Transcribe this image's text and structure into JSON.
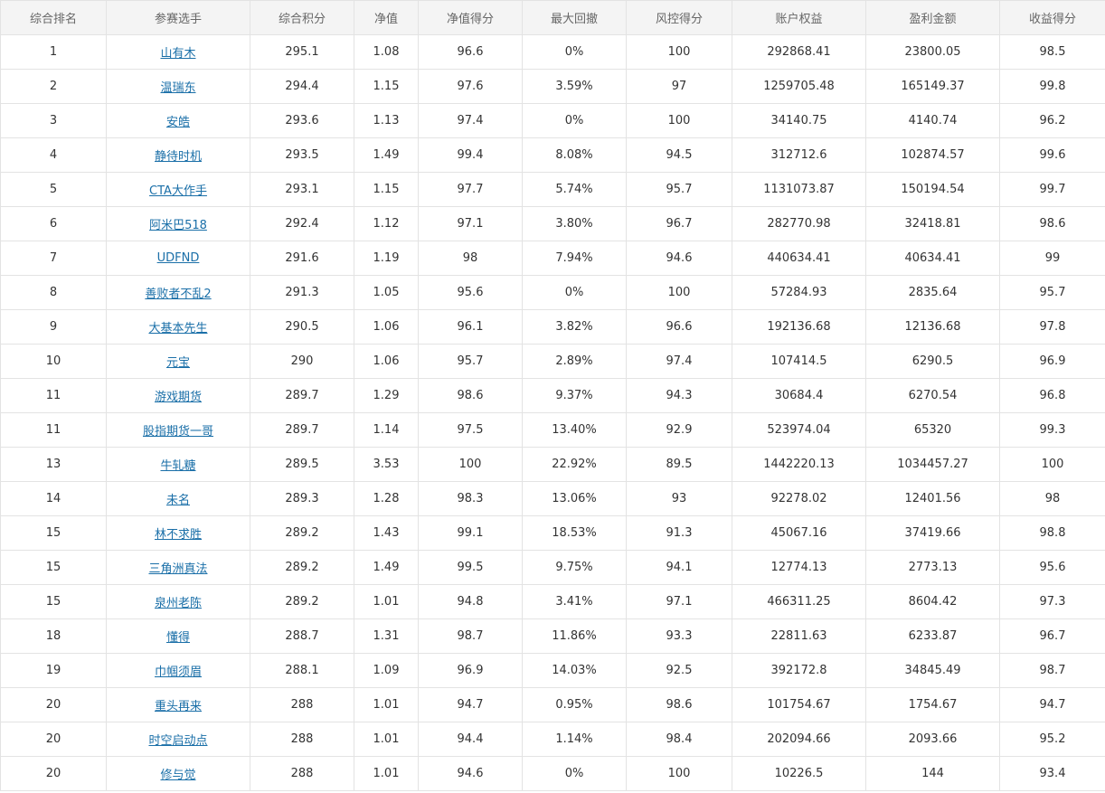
{
  "table": {
    "headers": [
      "综合排名",
      "参赛选手",
      "综合积分",
      "净值",
      "净值得分",
      "最大回撤",
      "风控得分",
      "账户权益",
      "盈利金额",
      "收益得分"
    ],
    "rows": [
      [
        "1",
        "山有木",
        "295.1",
        "1.08",
        "96.6",
        "0%",
        "100",
        "292868.41",
        "23800.05",
        "98.5"
      ],
      [
        "2",
        "温瑞东",
        "294.4",
        "1.15",
        "97.6",
        "3.59%",
        "97",
        "1259705.48",
        "165149.37",
        "99.8"
      ],
      [
        "3",
        "安皓",
        "293.6",
        "1.13",
        "97.4",
        "0%",
        "100",
        "34140.75",
        "4140.74",
        "96.2"
      ],
      [
        "4",
        "静待时机",
        "293.5",
        "1.49",
        "99.4",
        "8.08%",
        "94.5",
        "312712.6",
        "102874.57",
        "99.6"
      ],
      [
        "5",
        "CTA大作手",
        "293.1",
        "1.15",
        "97.7",
        "5.74%",
        "95.7",
        "1131073.87",
        "150194.54",
        "99.7"
      ],
      [
        "6",
        "阿米巴518",
        "292.4",
        "1.12",
        "97.1",
        "3.80%",
        "96.7",
        "282770.98",
        "32418.81",
        "98.6"
      ],
      [
        "7",
        "UDFND",
        "291.6",
        "1.19",
        "98",
        "7.94%",
        "94.6",
        "440634.41",
        "40634.41",
        "99"
      ],
      [
        "8",
        "善败者不乱2",
        "291.3",
        "1.05",
        "95.6",
        "0%",
        "100",
        "57284.93",
        "2835.64",
        "95.7"
      ],
      [
        "9",
        "大基本先生",
        "290.5",
        "1.06",
        "96.1",
        "3.82%",
        "96.6",
        "192136.68",
        "12136.68",
        "97.8"
      ],
      [
        "10",
        "元宝",
        "290",
        "1.06",
        "95.7",
        "2.89%",
        "97.4",
        "107414.5",
        "6290.5",
        "96.9"
      ],
      [
        "11",
        "游戏期货",
        "289.7",
        "1.29",
        "98.6",
        "9.37%",
        "94.3",
        "30684.4",
        "6270.54",
        "96.8"
      ],
      [
        "11",
        "股指期货一哥",
        "289.7",
        "1.14",
        "97.5",
        "13.40%",
        "92.9",
        "523974.04",
        "65320",
        "99.3"
      ],
      [
        "13",
        "牛轧糖",
        "289.5",
        "3.53",
        "100",
        "22.92%",
        "89.5",
        "1442220.13",
        "1034457.27",
        "100"
      ],
      [
        "14",
        "未名",
        "289.3",
        "1.28",
        "98.3",
        "13.06%",
        "93",
        "92278.02",
        "12401.56",
        "98"
      ],
      [
        "15",
        "林不求胜",
        "289.2",
        "1.43",
        "99.1",
        "18.53%",
        "91.3",
        "45067.16",
        "37419.66",
        "98.8"
      ],
      [
        "15",
        "三角洲真法",
        "289.2",
        "1.49",
        "99.5",
        "9.75%",
        "94.1",
        "12774.13",
        "2773.13",
        "95.6"
      ],
      [
        "15",
        "泉州老陈",
        "289.2",
        "1.01",
        "94.8",
        "3.41%",
        "97.1",
        "466311.25",
        "8604.42",
        "97.3"
      ],
      [
        "18",
        "懂得",
        "288.7",
        "1.31",
        "98.7",
        "11.86%",
        "93.3",
        "22811.63",
        "6233.87",
        "96.7"
      ],
      [
        "19",
        "巾帼须眉",
        "288.1",
        "1.09",
        "96.9",
        "14.03%",
        "92.5",
        "392172.8",
        "34845.49",
        "98.7"
      ],
      [
        "20",
        "重头再来",
        "288",
        "1.01",
        "94.7",
        "0.95%",
        "98.6",
        "101754.67",
        "1754.67",
        "94.7"
      ],
      [
        "20",
        "时空启动点",
        "288",
        "1.01",
        "94.4",
        "1.14%",
        "98.4",
        "202094.66",
        "2093.66",
        "95.2"
      ],
      [
        "20",
        "修与觉",
        "288",
        "1.01",
        "94.6",
        "0%",
        "100",
        "10226.5",
        "144",
        "93.4"
      ]
    ]
  },
  "colors": {
    "link": "#1a6fa8",
    "header_bg": "#f4f4f4",
    "border": "#e3e3e3"
  }
}
